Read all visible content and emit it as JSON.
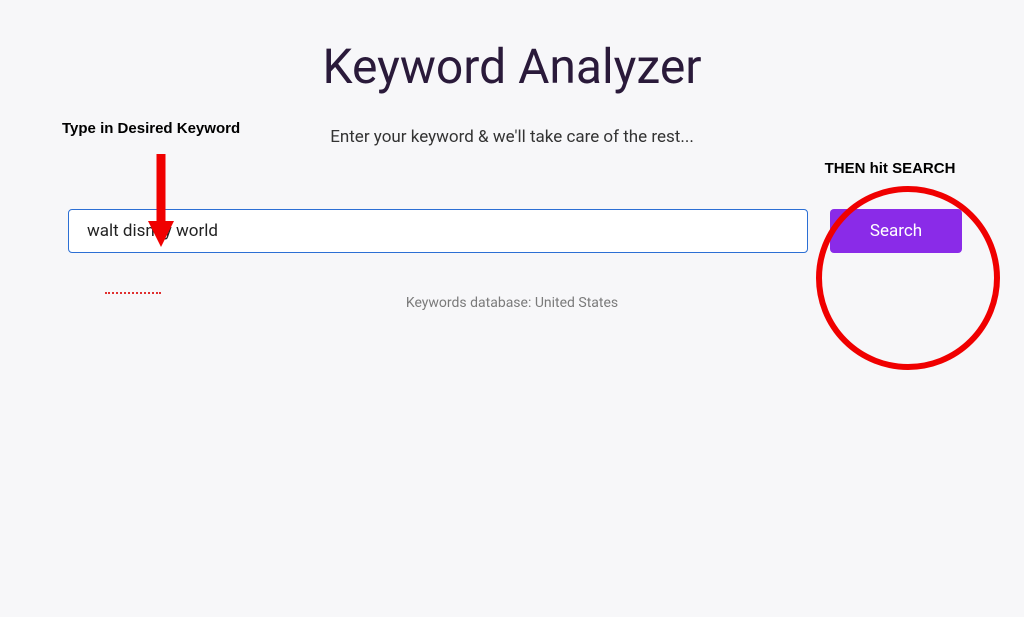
{
  "header": {
    "title": "Keyword Analyzer",
    "subtitle": "Enter your keyword & we'll take care of the rest..."
  },
  "search": {
    "value": "walt disney world",
    "button_label": "Search"
  },
  "footer": {
    "db_note": "Keywords database: United States"
  },
  "annotations": {
    "left_label": "Type in Desired Keyword",
    "right_label": "THEN hit SEARCH"
  }
}
